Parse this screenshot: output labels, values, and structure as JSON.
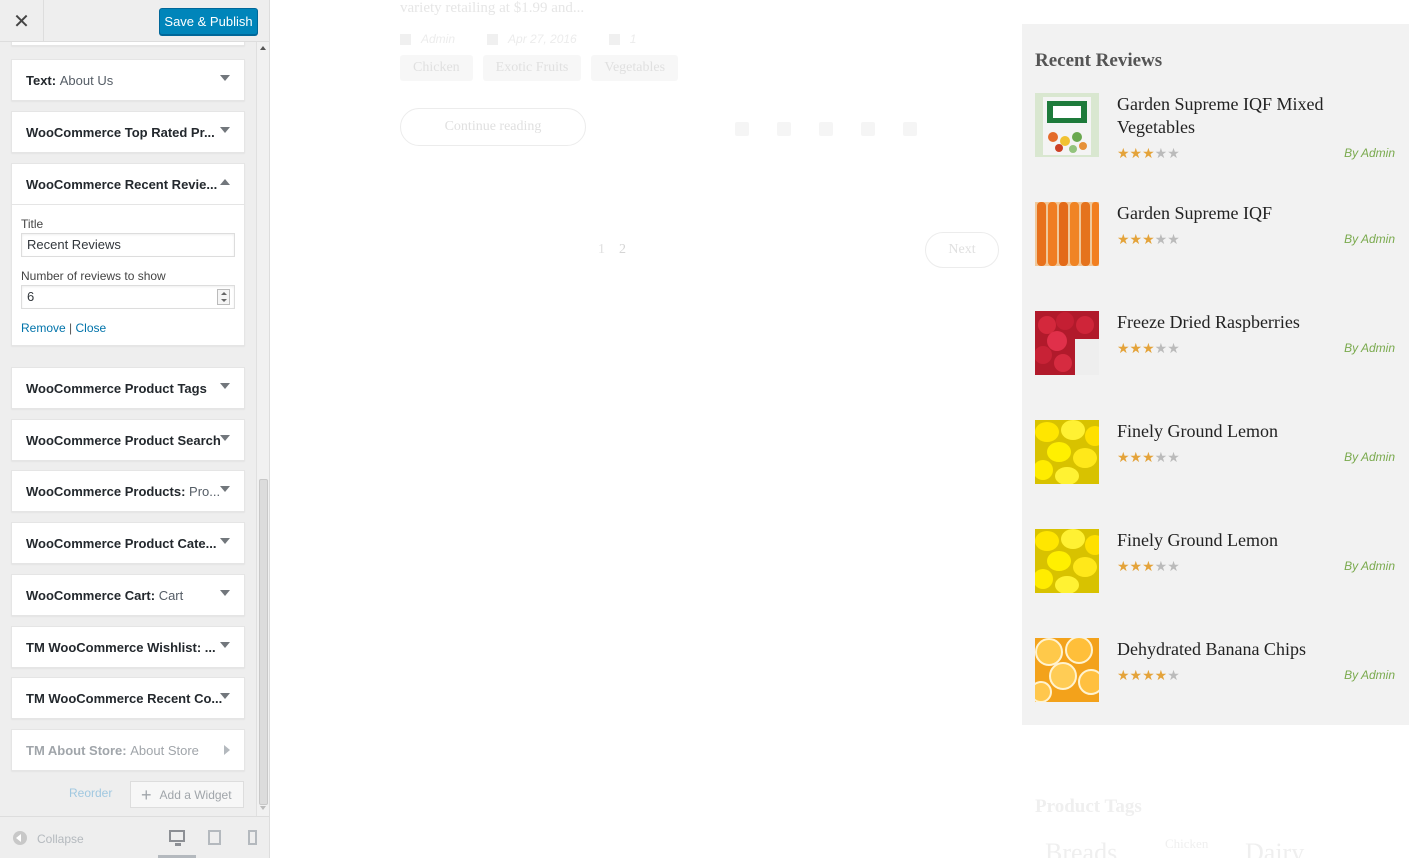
{
  "customizer": {
    "close_glyph": "✕",
    "save_label": "Save & Publish",
    "widgets": [
      {
        "title": "Text:",
        "sub": "About Us"
      },
      {
        "title": "WooCommerce Top Rated Pr...",
        "sub": ""
      },
      {
        "title": "WooCommerce Recent Revie...",
        "sub": ""
      },
      {
        "title": "WooCommerce Product Tags",
        "sub": ""
      },
      {
        "title": "WooCommerce Product Search",
        "sub": ""
      },
      {
        "title": "WooCommerce Products:",
        "sub": "Pro..."
      },
      {
        "title": "WooCommerce Product Cate...",
        "sub": ""
      },
      {
        "title": "WooCommerce Cart:",
        "sub": "Cart"
      },
      {
        "title": "TM WooCommerce Wishlist: ...",
        "sub": ""
      },
      {
        "title": "TM WooCommerce Recent Co...",
        "sub": ""
      },
      {
        "title": "TM About Store:",
        "sub": "About Store"
      }
    ],
    "open_widget": {
      "title_label": "Title",
      "title_value": "Recent Reviews",
      "number_label": "Number of reviews to show",
      "number_value": "6",
      "remove_label": "Remove",
      "separator": "|",
      "close_label": "Close"
    },
    "reorder_label": "Reorder",
    "add_widget_label": "Add a Widget",
    "collapse_label": "Collapse"
  },
  "preview": {
    "excerpt": "variety retailing at $1.99 and...",
    "meta": {
      "author": "Admin",
      "date": "Apr 27, 2016",
      "comments": "1"
    },
    "tags": [
      "Chicken",
      "Exotic Fruits",
      "Vegetables"
    ],
    "continue_label": "Continue reading",
    "pages": [
      "1",
      "2"
    ],
    "next_label": "Next",
    "reviews_title": "Recent Reviews",
    "reviews": [
      {
        "name": "Garden Supreme IQF Mixed Vegetables",
        "rating": 3,
        "by": "By Admin",
        "image": "mixed-vegetables-bag"
      },
      {
        "name": "Garden Supreme IQF",
        "rating": 3,
        "by": "By Admin",
        "image": "carrots"
      },
      {
        "name": "Freeze Dried Raspberries",
        "rating": 3,
        "by": "By Admin",
        "image": "raspberries"
      },
      {
        "name": "Finely Ground Lemon",
        "rating": 3,
        "by": "By Admin",
        "image": "lemons"
      },
      {
        "name": "Finely Ground Lemon",
        "rating": 3,
        "by": "By Admin",
        "image": "lemons"
      },
      {
        "name": "Dehydrated Banana Chips",
        "rating": 4,
        "by": "By Admin",
        "image": "orange-slices"
      }
    ],
    "product_tags_title": "Product Tags",
    "tag_cloud": [
      "Breads",
      "Chicken",
      "Dairy"
    ]
  },
  "colors": {
    "accent": "#0085ba",
    "link": "#0073aa",
    "star": "#e4a33a",
    "byline": "#7aaa4e"
  }
}
